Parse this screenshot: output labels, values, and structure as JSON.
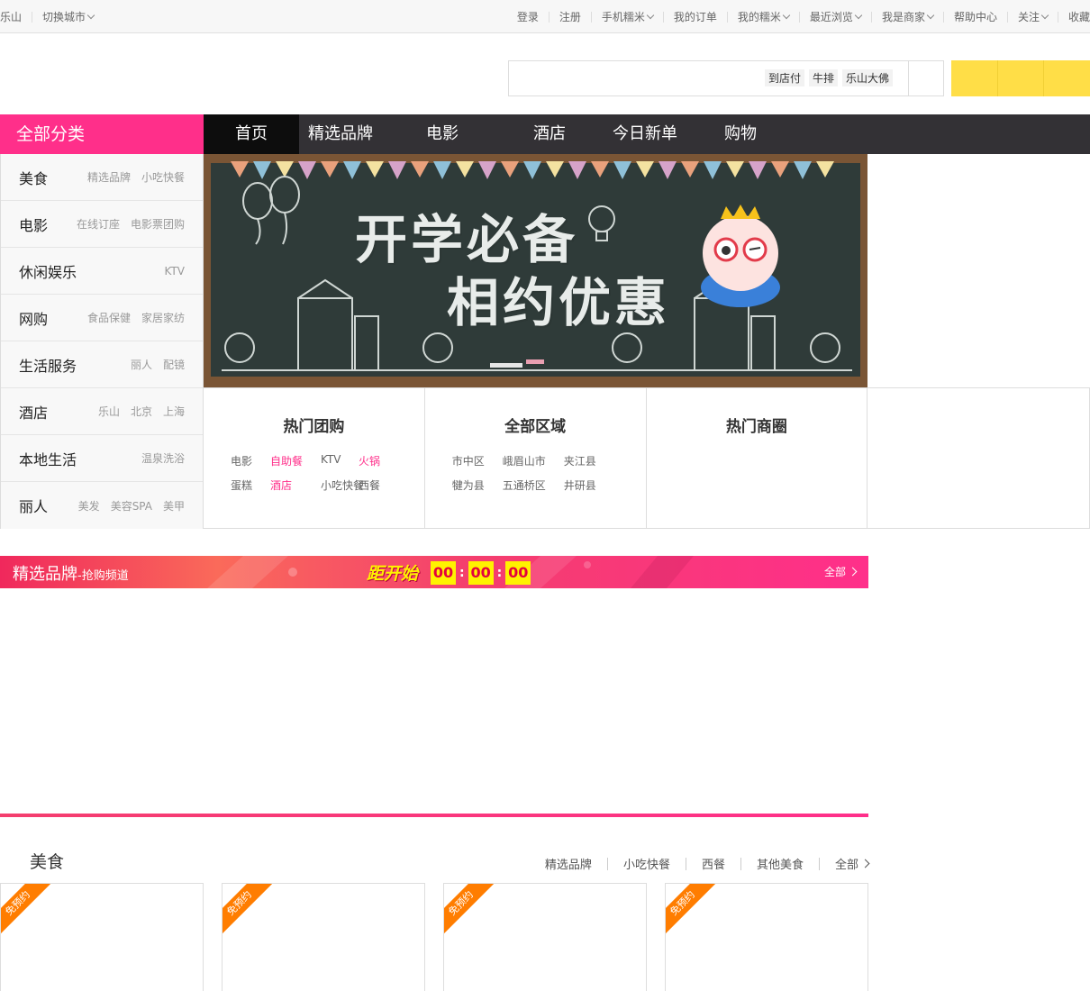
{
  "topbar": {
    "city": "乐山",
    "switch_city": "切换城市",
    "links": {
      "login": "登录",
      "register": "注册",
      "mobile": "手机糯米",
      "orders": "我的订单",
      "my_nuomi": "我的糯米",
      "recent": "最近浏览",
      "merchant": "我是商家",
      "help": "帮助中心",
      "follow": "关注",
      "favorite": "收藏"
    }
  },
  "search": {
    "placeholder": "",
    "hot_words": [
      "到店付",
      "牛排",
      "乐山大佛"
    ]
  },
  "nav": {
    "all_categories": "全部分类",
    "items": [
      "首页",
      "精选品牌",
      "电影",
      "酒店",
      "今日新单",
      "购物"
    ]
  },
  "categories": [
    {
      "title": "美食",
      "subs": [
        "精选品牌",
        "小吃快餐"
      ]
    },
    {
      "title": "电影",
      "subs": [
        "在线订座",
        "电影票团购"
      ]
    },
    {
      "title": "休闲娱乐",
      "subs": [
        "KTV"
      ]
    },
    {
      "title": "网购",
      "subs": [
        "食品保健",
        "家居家纺"
      ]
    },
    {
      "title": "生活服务",
      "subs": [
        "丽人",
        "配镜"
      ]
    },
    {
      "title": "酒店",
      "subs": [
        "乐山",
        "北京",
        "上海"
      ]
    },
    {
      "title": "本地生活",
      "subs": [
        "温泉洗浴"
      ]
    },
    {
      "title": "丽人",
      "subs": [
        "美发",
        "美容SPA",
        "美甲"
      ]
    }
  ],
  "banner": {
    "line1": "开学必备",
    "line2": "相约优惠"
  },
  "panels": {
    "hot_group": {
      "title": "热门团购",
      "links": [
        "电影",
        "自助餐",
        "KTV",
        "火锅",
        "蛋糕",
        "酒店",
        "小吃快餐",
        "西餐"
      ],
      "highlighted": [
        "自助餐",
        "火锅",
        "酒店"
      ]
    },
    "areas": {
      "title": "全部区域",
      "links": [
        "市中区",
        "峨眉山市",
        "夹江县",
        "犍为县",
        "五通桥区",
        "井研县"
      ]
    },
    "business": {
      "title": "热门商圈"
    }
  },
  "flash_sale": {
    "title": "精选品牌",
    "subtitle": "-抢购频道",
    "countdown_label": "距开始",
    "hours": "00",
    "minutes": "00",
    "seconds": "00",
    "all_label": "全部"
  },
  "food_section": {
    "title": "美食",
    "tabs": [
      "精选品牌",
      "小吃快餐",
      "西餐",
      "其他美食"
    ],
    "all_label": "全部",
    "card_badge": "免预约",
    "card_count": 4
  },
  "colors": {
    "accent_pink": "#ff2f8a",
    "nav_dark": "#333135",
    "yellow": "#ffde47",
    "badge_orange": "#ff7d00"
  }
}
